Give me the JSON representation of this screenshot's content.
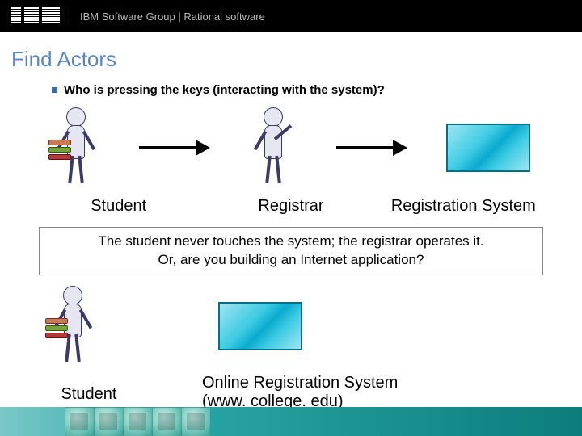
{
  "header": {
    "org": "IBM Software Group | Rational software"
  },
  "title": "Find Actors",
  "bullet": "Who is pressing the keys (interacting with the system)?",
  "row1": {
    "actor1": "Student",
    "actor2": "Registrar",
    "system": "Registration System"
  },
  "note": {
    "line1": "The student never touches the system; the registrar operates it.",
    "line2": "Or, are you building an Internet application?"
  },
  "row2": {
    "actor": "Student",
    "system_line1": "Online Registration System",
    "system_line2": "(www. college. edu)"
  }
}
